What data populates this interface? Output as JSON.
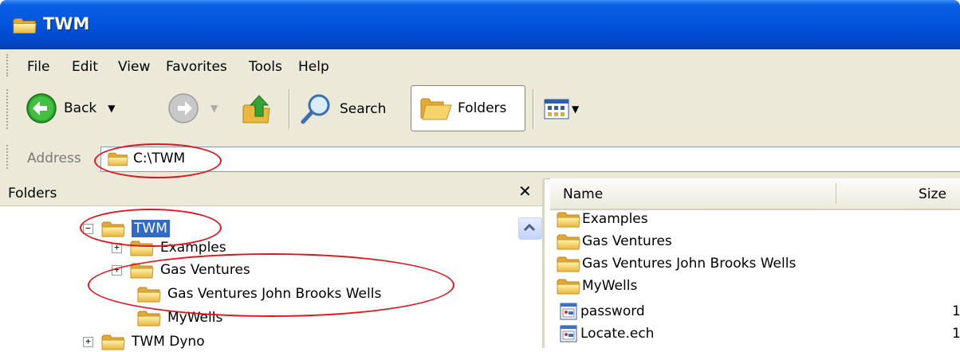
{
  "window": {
    "title": "TWM"
  },
  "menu": [
    "File",
    "Edit",
    "View",
    "Favorites",
    "Tools",
    "Help"
  ],
  "toolbar": {
    "back_label": "Back",
    "search_label": "Search",
    "folders_label": "Folders"
  },
  "address": {
    "label": "Address",
    "value": "C:\\TWM"
  },
  "folders_pane": {
    "header": "Folders",
    "close_glyph": "✕",
    "tree": [
      {
        "label": "TWM",
        "expander": "⊟",
        "selected": true
      },
      {
        "label": "Examples",
        "expander": "⊞"
      },
      {
        "label": "Gas Ventures",
        "expander": "⊞"
      },
      {
        "label": "Gas Ventures John Brooks Wells",
        "expander": ""
      },
      {
        "label": "MyWells",
        "expander": ""
      },
      {
        "label": "TWM Dyno",
        "expander": "⊞"
      }
    ]
  },
  "file_list": {
    "columns": [
      "Name",
      "Size"
    ],
    "items": [
      {
        "name": "Examples",
        "type": "folder"
      },
      {
        "name": "Gas Ventures",
        "type": "folder"
      },
      {
        "name": "Gas Ventures John Brooks Wells",
        "type": "folder"
      },
      {
        "name": "MyWells",
        "type": "folder"
      },
      {
        "name": "password",
        "type": "file",
        "size": "1"
      },
      {
        "name": "Locate.ech",
        "type": "file",
        "size": "1"
      }
    ]
  },
  "colors": {
    "title_blue": "#0254dc",
    "chrome": "#ece9d8",
    "selection": "#316ac5",
    "annotation_red": "#e0141e"
  }
}
